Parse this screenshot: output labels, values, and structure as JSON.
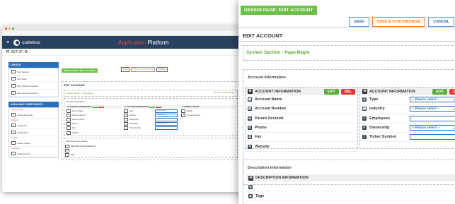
{
  "bg_app": {
    "brand": "codeless",
    "title_part1": "Application",
    "title_part2": "Platform",
    "setup_label": "SETUP",
    "create_panel": {
      "title": "CREATE",
      "items": [
        "New Section",
        "New Field",
        "New Child Component",
        "New Grid Component"
      ]
    },
    "components_panel": {
      "title": "AVAILABLE COMPONENTS",
      "groups": [
        {
          "heading": "Account Fields",
          "items": [
            "Annual Revenue"
          ]
        },
        {
          "heading": "Contacts",
          "items": [
            "Created At",
            "Created On"
          ]
        },
        {
          "heading": "Location",
          "items": [
            "Local Location"
          ]
        },
        {
          "heading": "Addresses",
          "items": [
            "Child Account"
          ]
        }
      ]
    },
    "mini": {
      "design_tag": "DESIGN PAGE: EDIT ACCOUNT",
      "buttons": [
        "SAVE",
        "SAVE & SYNCHRONIZE",
        "CANCEL"
      ],
      "edit_account": "EDIT ACCOUNT",
      "system_section": "System Section - Page Begin",
      "system_right": "This section should always...",
      "account_info": "Account Information",
      "desc_info": "Description Information",
      "col3_title": "OWNER & DETAIL",
      "col3_fields": [
        "Rating",
        "Annual Revenue"
      ],
      "desc_fields": [
        "DESCRIPTION INFORMATION",
        "",
        "Tags"
      ]
    }
  },
  "panel": {
    "design_tag": "DESIGN PAGE: EDIT ACCOUNT",
    "buttons": {
      "save": "SAVE",
      "save_sync": "SAVE & SYNCHRONIZE",
      "cancel": "CANCEL"
    },
    "edit_account": "EDIT ACCOUNT",
    "system_section": "System Section - Page Begin",
    "account_info_label": "Account Information",
    "left_column": {
      "title": "ACCOUNT INFORMATION",
      "edit": "EDIT",
      "del": "DEL",
      "fields": [
        "Account Name",
        "Account Number",
        "Parent Account",
        "Phone",
        "Fax",
        "Website"
      ]
    },
    "right_column": {
      "title": "ACCOUNT INFORMATION",
      "edit": "EDIT",
      "del": "D",
      "fields": [
        {
          "label": "Type",
          "control": "-- Please select --"
        },
        {
          "label": "Industry",
          "control": "-- Please select --"
        },
        {
          "label": "Employees",
          "control": ""
        },
        {
          "label": "Ownership",
          "control": "-- Please select --"
        },
        {
          "label": "Ticker Symbol",
          "control": ""
        }
      ]
    },
    "description_label": "Description Information",
    "description_header": "DESCRIPTION INFORMATION",
    "desc_rows": [
      "",
      "Tags"
    ]
  },
  "colors": {
    "green": "#6cbf45",
    "red": "#d93a3a",
    "blue": "#2e6eb5",
    "orange": "#f07d2e",
    "navy": "#27415f"
  }
}
